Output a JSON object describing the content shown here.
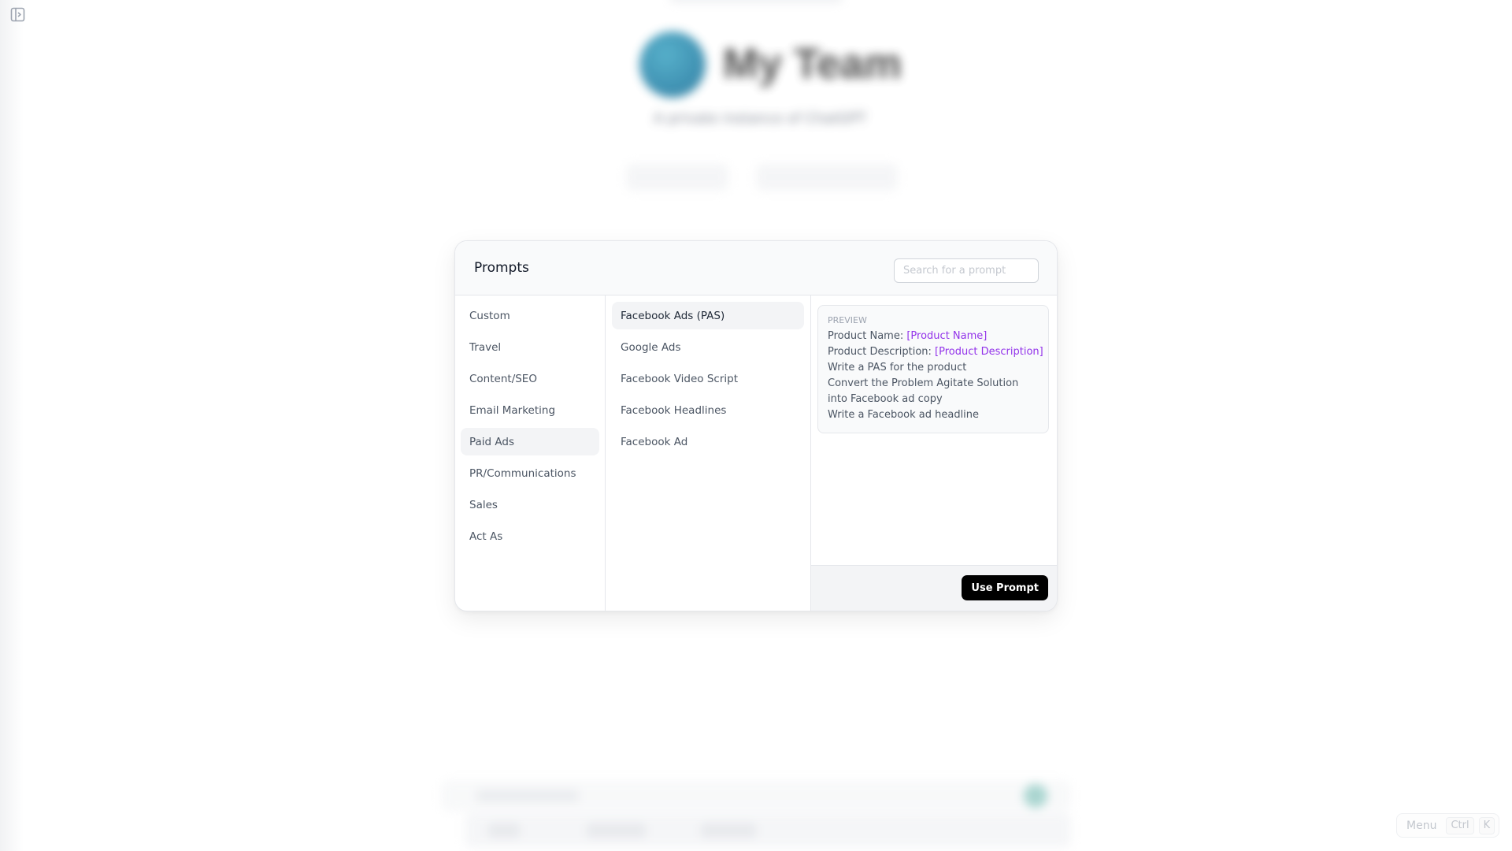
{
  "background": {
    "title": "My Team",
    "subtitle": "A private instance of ChatGPT"
  },
  "panel": {
    "title": "Prompts",
    "search": {
      "placeholder": "Search for a prompt",
      "value": ""
    },
    "categories": [
      {
        "label": "Custom",
        "selected": false
      },
      {
        "label": "Travel",
        "selected": false
      },
      {
        "label": "Content/SEO",
        "selected": false
      },
      {
        "label": "Email Marketing",
        "selected": false
      },
      {
        "label": "Paid Ads",
        "selected": true
      },
      {
        "label": "PR/Communications",
        "selected": false
      },
      {
        "label": "Sales",
        "selected": false
      },
      {
        "label": "Act As",
        "selected": false
      }
    ],
    "prompts": [
      {
        "label": "Facebook Ads (PAS)",
        "selected": true
      },
      {
        "label": "Google Ads",
        "selected": false
      },
      {
        "label": "Facebook Video Script",
        "selected": false
      },
      {
        "label": "Facebook Headlines",
        "selected": false
      },
      {
        "label": "Facebook Ad",
        "selected": false
      }
    ],
    "preview": {
      "label": "PREVIEW",
      "lines": [
        {
          "text": "Product Name: ",
          "var": "[Product Name]"
        },
        {
          "text": "Product Description: ",
          "var": "[Product Description]"
        },
        {
          "text": "Write a PAS for the product",
          "var": ""
        },
        {
          "text": "Convert the Problem Agitate Solution into Facebook ad copy",
          "var": ""
        },
        {
          "text": "Write a Facebook ad headline",
          "var": ""
        }
      ]
    },
    "use_prompt_label": "Use Prompt"
  },
  "shortcut": {
    "label": "Menu",
    "keys": [
      "Ctrl",
      "K"
    ]
  },
  "colors": {
    "accent_variable": "#9333ea",
    "button_bg": "#000000",
    "selected_bg": "#f3f4f6"
  }
}
